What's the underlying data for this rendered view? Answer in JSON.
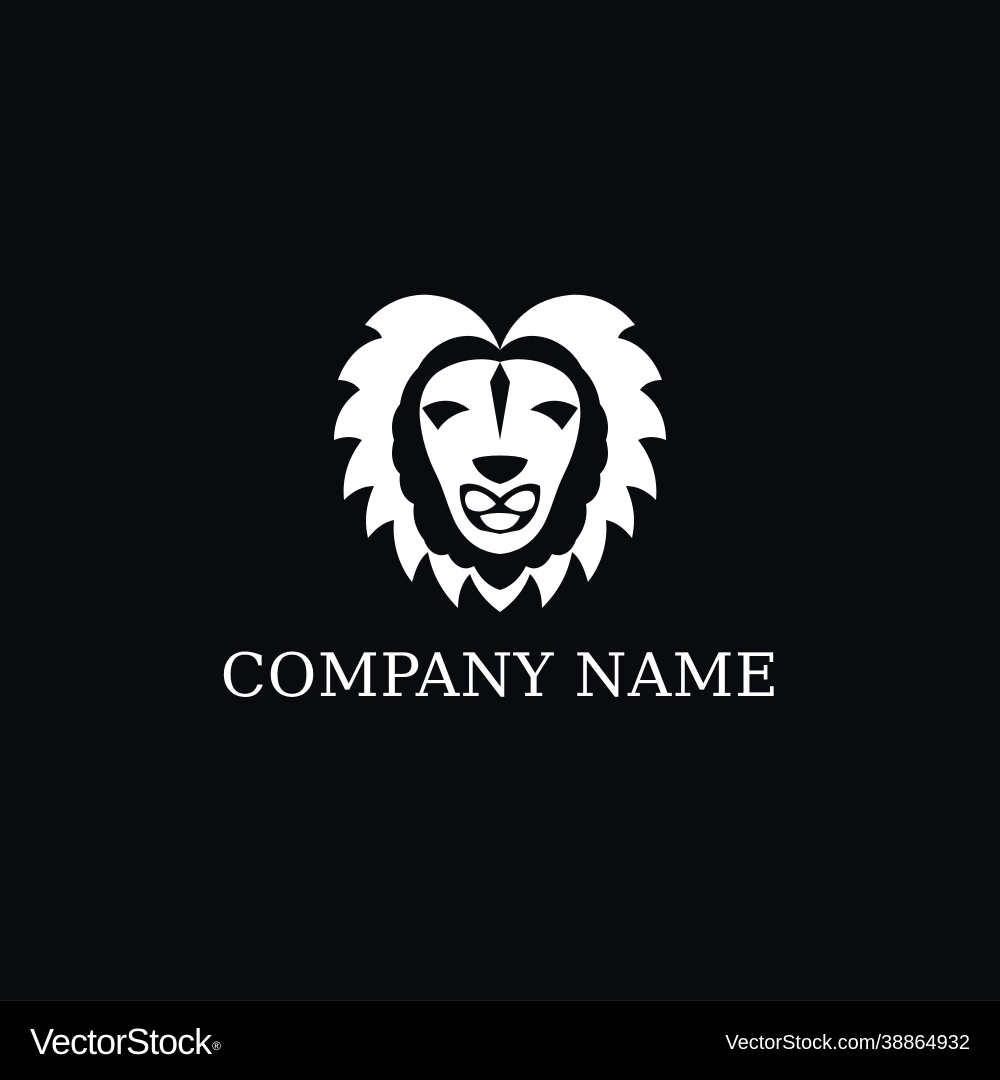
{
  "logo": {
    "icon": "lion-head-icon",
    "company_name": "COMPANY NAME",
    "text_color": "#ffffff",
    "background_color": "#0a0b0e"
  },
  "footer": {
    "brand": "VectorStock",
    "brand_mark": "®",
    "image_id": "VectorStock.com/38864932",
    "background_color": "#000000"
  }
}
